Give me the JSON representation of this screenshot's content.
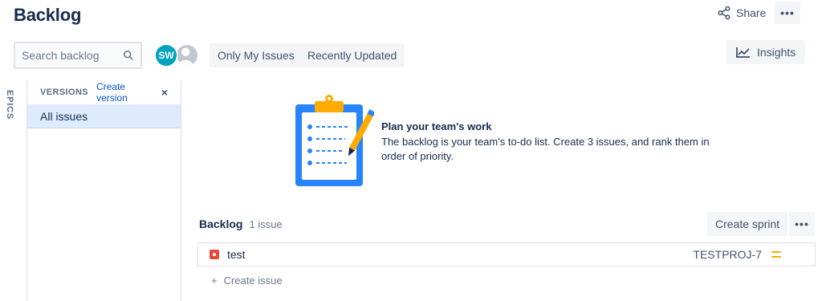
{
  "header": {
    "title": "Backlog",
    "share_label": "Share",
    "more_label": "•••",
    "share_icon": "share-icon"
  },
  "toolbar": {
    "search_placeholder": "Search backlog",
    "avatar_initials": "SW",
    "avatar_color": "#00a3bf",
    "quick_filters": [
      "Only My Issues",
      "Recently Updated"
    ],
    "insights_label": "Insights"
  },
  "sidebar": {
    "epics_label": "EPICS",
    "versions_title": "VERSIONS",
    "create_version_label": "Create version",
    "close_label": "×",
    "items": [
      {
        "label": "All issues",
        "selected": true
      }
    ]
  },
  "empty_state": {
    "title": "Plan your team's work",
    "description": "The backlog is your team's to-do list. Create 3 issues, and rank them in order of priority."
  },
  "backlog": {
    "title": "Backlog",
    "count": "1 issue",
    "create_sprint_label": "Create sprint",
    "more_label": "•••",
    "issues": [
      {
        "summary": "test",
        "key": "TESTPROJ-7",
        "type": "bug",
        "priority": "medium",
        "type_color": "#e5493a",
        "priority_color": "#ffab00"
      }
    ],
    "create_issue_label": "Create issue",
    "create_issue_plus": "+"
  }
}
